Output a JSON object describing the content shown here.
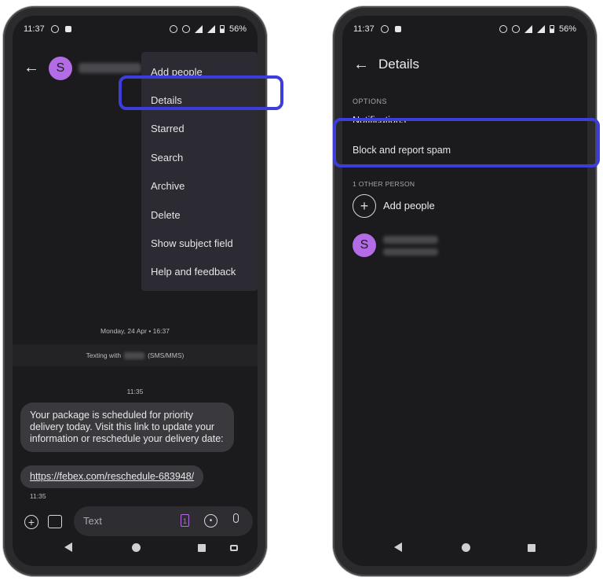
{
  "left": {
    "status": {
      "time": "11:37",
      "battery": "56%"
    },
    "contact_initial": "S",
    "menu": [
      "Add people",
      "Details",
      "Starred",
      "Search",
      "Archive",
      "Delete",
      "Show subject field",
      "Help and feedback"
    ],
    "date_divider": "Monday, 24 Apr • 16:37",
    "texting_prefix": "Texting with",
    "texting_suffix": "(SMS/MMS)",
    "msg_time": "11:35",
    "message": "Your package is scheduled for priority delivery today. Visit this link to update your information or reschedule your delivery date:",
    "link": "https://febex.com/reschedule-683948/",
    "sent_time": "11:35",
    "composer_placeholder": "Text",
    "sim_badge": "1"
  },
  "right": {
    "status": {
      "time": "11:37",
      "battery": "56%"
    },
    "title": "Details",
    "options_header": "OPTIONS",
    "notifications": "Notifications",
    "block": "Block and report spam",
    "people_header": "1 OTHER PERSON",
    "add_people": "Add people",
    "contact_initial": "S"
  },
  "colors": {
    "highlight": "#3d3ddd",
    "avatar": "#b46be6",
    "background": "#1b1b1d"
  }
}
